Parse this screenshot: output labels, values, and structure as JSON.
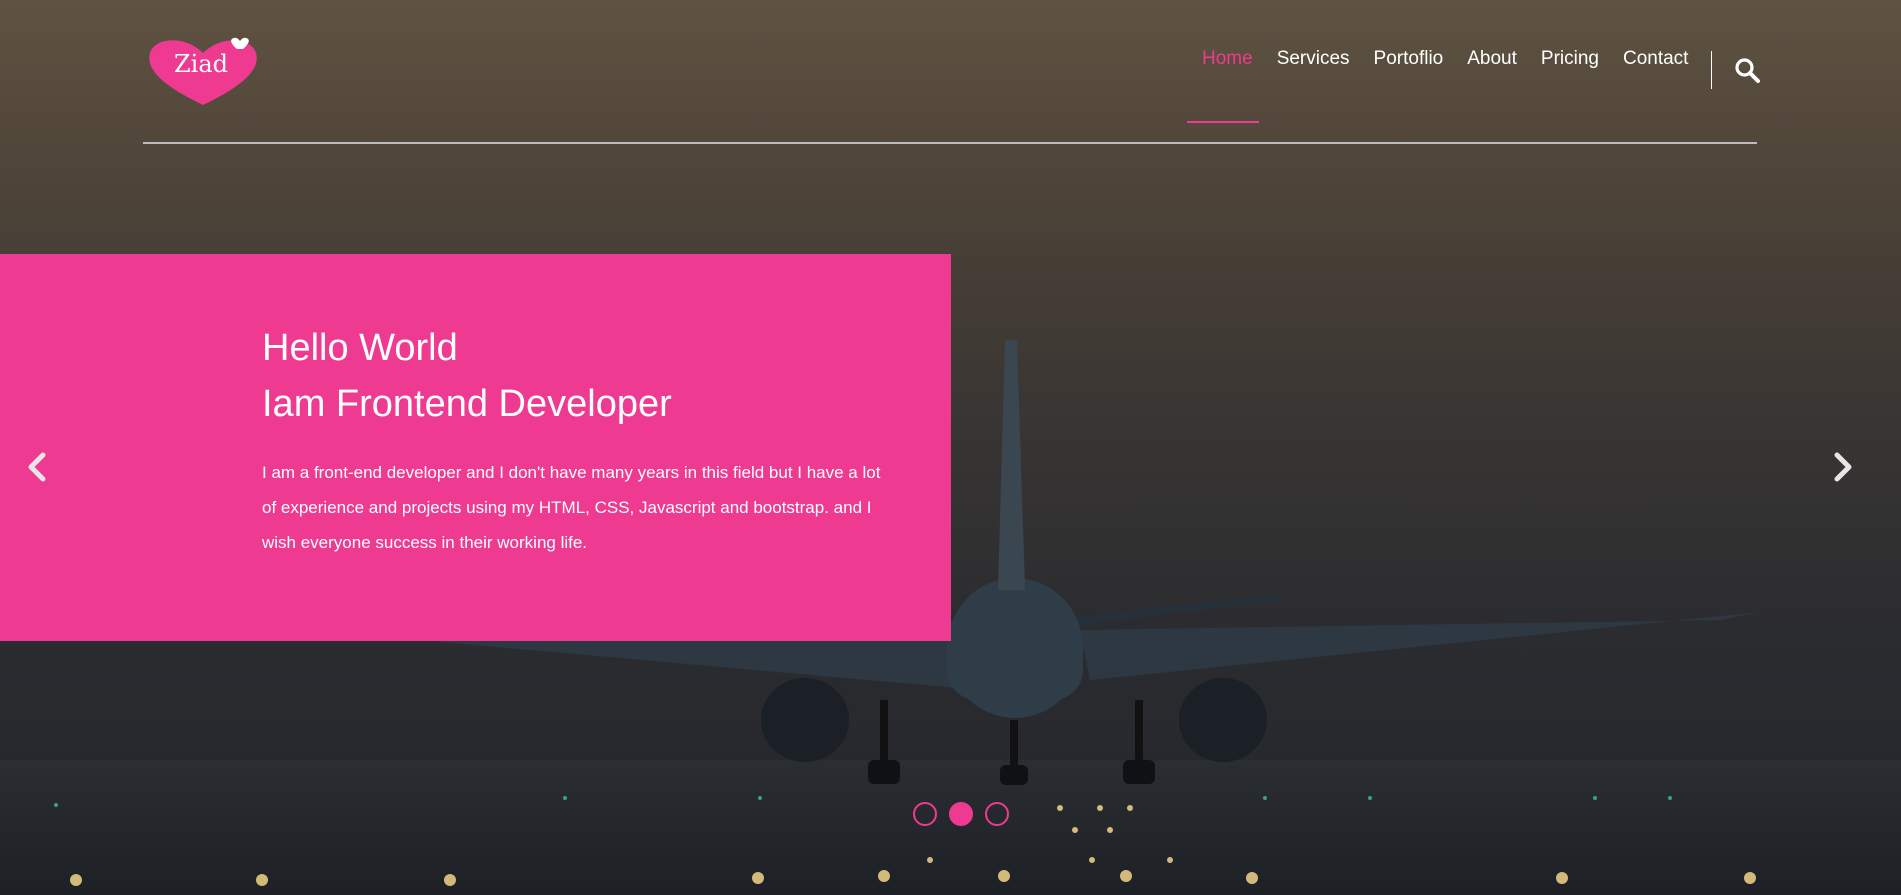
{
  "brand": {
    "logo_text": "Ziad",
    "accent_color": "#ef3a91"
  },
  "nav": {
    "items": [
      {
        "label": "Home",
        "active": true
      },
      {
        "label": "Services"
      },
      {
        "label": "Portoflio"
      },
      {
        "label": "About"
      },
      {
        "label": "Pricing"
      },
      {
        "label": "Contact"
      }
    ],
    "search_icon": "search-icon"
  },
  "hero": {
    "title_line1": "Hello World",
    "title_line2": "Iam Frontend Developer",
    "description": "I am a front-end developer and I don't have many years in this field but I have a lot of experience and projects using my HTML, CSS, Javascript and bootstrap. and I wish everyone success in their working life.",
    "prev_icon": "chevron-left-icon",
    "next_icon": "chevron-right-icon",
    "slide_count": 3,
    "active_slide": 2
  }
}
